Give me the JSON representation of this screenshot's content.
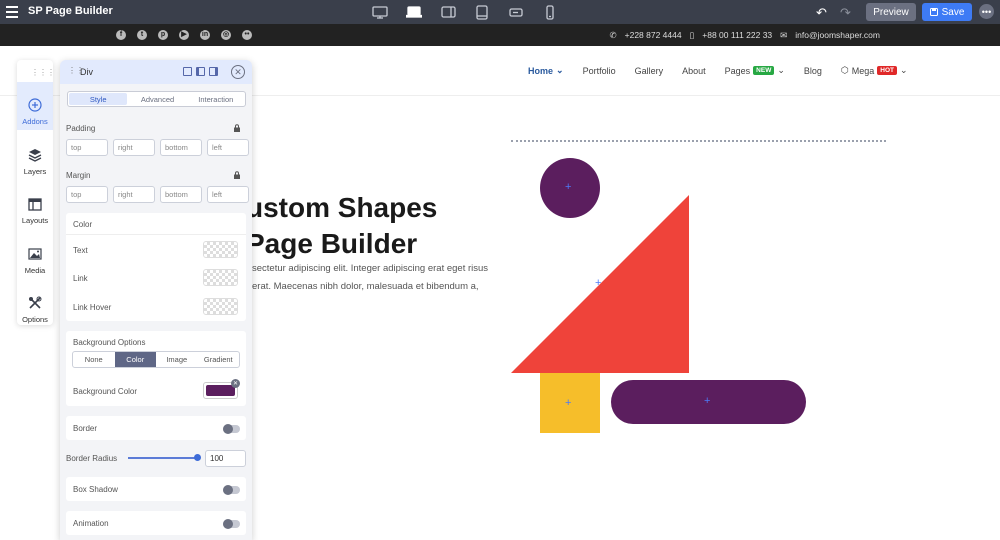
{
  "app": {
    "title": "SP Page Builder",
    "undo_icon": "undo-icon",
    "redo_icon": "redo-icon",
    "preview_label": "Preview",
    "save_label": "Save",
    "more_label": "•••",
    "devices": [
      "desktop-icon",
      "laptop-icon",
      "tablet-landscape-icon",
      "tablet-portrait-icon",
      "phone-landscape-icon",
      "phone-portrait-icon"
    ],
    "active_device": "laptop-icon"
  },
  "infobar": {
    "socials": [
      "facebook-icon",
      "twitter-icon",
      "pinterest-icon",
      "youtube-icon",
      "linkedin-icon",
      "instagram-icon",
      "flickr-icon"
    ],
    "phone1": "+228 872 4444",
    "phone2": "+88 00 111 222 33",
    "email": "info@joomshaper.com"
  },
  "nav": {
    "items": [
      {
        "label": "Home",
        "dropdown": true,
        "active": true
      },
      {
        "label": "Portfolio"
      },
      {
        "label": "Gallery"
      },
      {
        "label": "About"
      },
      {
        "label": "Pages",
        "badge": "NEW",
        "dropdown": true
      },
      {
        "label": "Blog"
      },
      {
        "label": "Mega",
        "badge": "HOT",
        "dropdown": true
      }
    ],
    "colors": {
      "active": "#2a5a9e",
      "new_badge": "#27a843",
      "hot_badge": "#e02828"
    }
  },
  "hero": {
    "title_line1": "ustom Shapes",
    "title_line2": "Page Builder",
    "text_line1": "sectetur adipiscing elit. Integer adipiscing erat eget risus",
    "text_line2": "erat. Maecenas nibh dolor, malesuada et bibendum a,"
  },
  "shapes": {
    "plus": "+",
    "purple": "#5b1e5e",
    "red": "#ef433a",
    "yellow": "#f6be2a"
  },
  "sidebar": {
    "items": [
      {
        "label": "Addons",
        "icon": "add-circle-icon",
        "active": true
      },
      {
        "label": "Layers",
        "icon": "layers-icon"
      },
      {
        "label": "Layouts",
        "icon": "layouts-icon"
      },
      {
        "label": "Media",
        "icon": "media-icon"
      },
      {
        "label": "Options",
        "icon": "tools-icon"
      }
    ]
  },
  "panel": {
    "title": "Div",
    "tabs": [
      "Style",
      "Advanced",
      "Interaction"
    ],
    "active_tab": "Style",
    "padding_label": "Padding",
    "margin_label": "Margin",
    "placeholders": [
      "top",
      "right",
      "bottom",
      "left"
    ],
    "color_section": {
      "title": "Color",
      "rows": [
        "Text",
        "Link",
        "Link Hover"
      ]
    },
    "background": {
      "title": "Background Options",
      "options": [
        "None",
        "Color",
        "Image",
        "Gradient"
      ],
      "active": "Color",
      "color_label": "Background Color",
      "color_value": "#5b1e5e"
    },
    "border_label": "Border",
    "border_radius_label": "Border Radius",
    "border_radius_value": "100",
    "box_shadow_label": "Box Shadow",
    "animation_label": "Animation"
  }
}
